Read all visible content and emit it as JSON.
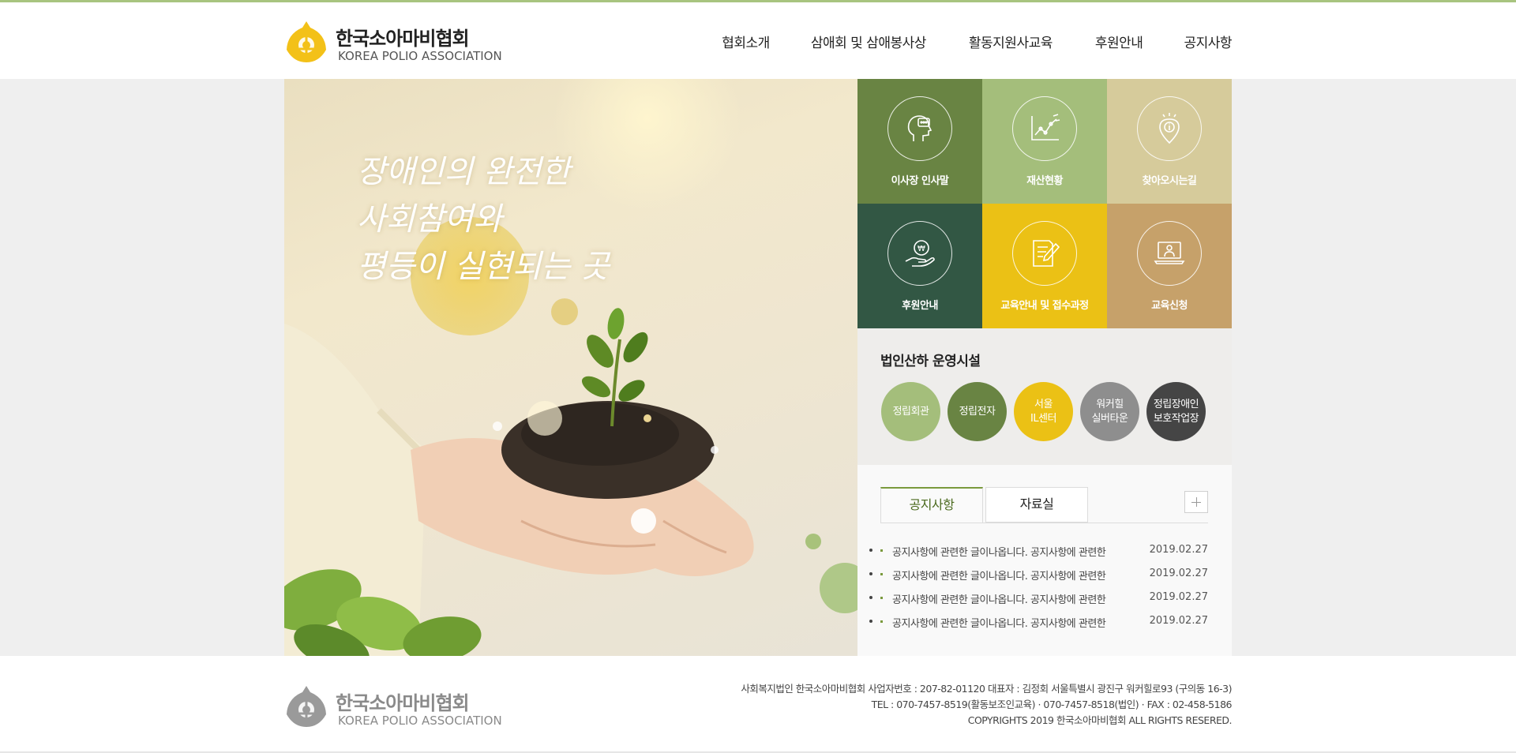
{
  "brand": {
    "name_ko": "한국소아마비협회",
    "name_en": "KOREA POLIO ASSOCIATION",
    "colors": {
      "yellow": "#f3c118",
      "green": "#698443",
      "light_green": "#a4be7b",
      "beige": "#d6cb9b",
      "dark_green": "#325744",
      "mustard": "#ebc115",
      "tan": "#c6a16a"
    }
  },
  "nav": {
    "items": [
      {
        "label": "협회소개"
      },
      {
        "label": "삼애회 및 삼애봉사상"
      },
      {
        "label": "활동지원사교육"
      },
      {
        "label": "후원안내"
      },
      {
        "label": "공지사항"
      }
    ]
  },
  "hero": {
    "lines": [
      "장애인의 완전한",
      "사회참여와",
      "평등이 실현되는 곳"
    ]
  },
  "tiles": [
    {
      "label": "이사장 인사말",
      "icon": "head-speech-icon",
      "color": "#698443"
    },
    {
      "label": "재산현황",
      "icon": "chart-growth-icon",
      "color": "#a4be7b"
    },
    {
      "label": "찾아오시는길",
      "icon": "location-pin-icon",
      "color": "#d6cb9b"
    },
    {
      "label": "후원안내",
      "icon": "donation-hand-icon",
      "color": "#325744"
    },
    {
      "label": "교육안내 및 접수과정",
      "icon": "document-edit-icon",
      "color": "#ebc115"
    },
    {
      "label": "교육신청",
      "icon": "laptop-user-icon",
      "color": "#c6a16a"
    }
  ],
  "facilities": {
    "title": "법인산하 운영시설",
    "items": [
      {
        "label": "정립회관",
        "color": "#a4be7b"
      },
      {
        "label": "정립전자",
        "color": "#698443"
      },
      {
        "label": "서울\nIL센터",
        "color": "#ebc115"
      },
      {
        "label": "워커힐\n실버타운",
        "color": "#8e8e8e"
      },
      {
        "label": "정립장애인\n보호작업장",
        "color": "#454545"
      }
    ]
  },
  "board": {
    "tabs": [
      {
        "label": "공지사항"
      },
      {
        "label": "자료실"
      }
    ],
    "posts": [
      {
        "title": "공지사항에 관련한 글이나옵니다. 공지사항에 관련한",
        "date": "2019.02.27"
      },
      {
        "title": "공지사항에 관련한 글이나옵니다. 공지사항에 관련한",
        "date": "2019.02.27"
      },
      {
        "title": "공지사항에 관련한 글이나옵니다. 공지사항에 관련한",
        "date": "2019.02.27"
      },
      {
        "title": "공지사항에 관련한 글이나옵니다. 공지사항에 관련한",
        "date": "2019.02.27"
      }
    ]
  },
  "footer": {
    "line1": "사회복지법인 한국소아마비협회  사업자번호 : 207-82-01120   대표자 : 김정회  서울특별시 광진구 워커힐로93 (구의동 16-3)",
    "line2": "TEL : 070-7457-8519(활동보조인교육) · 070-7457-8518(법인) · FAX : 02-458-5186",
    "line3": "COPYRIGHTS 2019 한국소아마비협회 ALL RIGHTS RESERED."
  }
}
